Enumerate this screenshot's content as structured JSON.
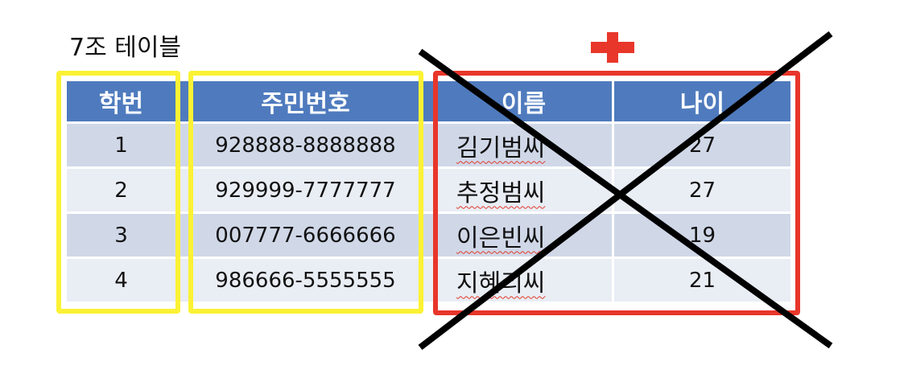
{
  "title": "7조 테이블",
  "table": {
    "headers": [
      "학번",
      "주민번호",
      "이름",
      "나이"
    ],
    "rows": [
      [
        "1",
        "928888-8888888",
        "김기범씨",
        "27"
      ],
      [
        "2",
        "929999-7777777",
        "추정범씨",
        "27"
      ],
      [
        "3",
        "007777-6666666",
        "이은빈씨",
        "19"
      ],
      [
        "4",
        "986666-5555555",
        "지혜리씨",
        "21"
      ]
    ]
  },
  "icons": {
    "plus": "plus-icon",
    "cross": "x-cross-icon"
  },
  "colors": {
    "header_bg": "#4f7bbe",
    "row_odd": "#d0d8e8",
    "row_even": "#e9edf4",
    "highlight_yellow": "#fbf234",
    "highlight_red": "#e8362a",
    "cross": "#000000",
    "plus": "#e8362a"
  }
}
